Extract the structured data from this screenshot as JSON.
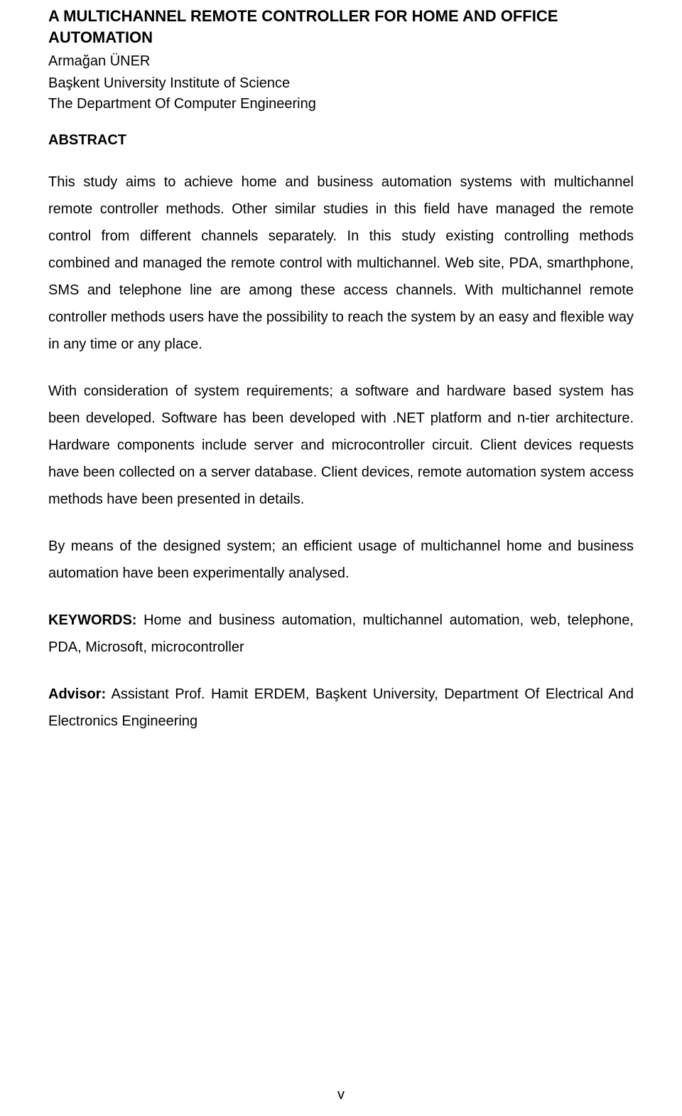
{
  "title": "A MULTICHANNEL REMOTE CONTROLLER FOR HOME AND OFFICE AUTOMATION",
  "author": "Armağan ÜNER",
  "affiliation": "Başkent University Institute of Science",
  "department": "The Department Of Computer Engineering",
  "abstract_heading": "ABSTRACT",
  "paragraphs": {
    "p1": "This study aims to achieve home and business automation systems with multichannel remote controller methods. Other similar studies in this field have managed the remote control from different channels separately. In this study existing controlling methods combined and managed the remote control with multichannel. Web site, PDA, smarthphone, SMS and telephone line are among these access channels. With multichannel remote controller methods users have the possibility to reach the system by an easy and flexible way in any time or any place.",
    "p2": "With consideration of system requirements; a software and hardware based system has been developed. Software has been developed with .NET platform and n-tier architecture. Hardware components include server and microcontroller circuit. Client devices requests have been collected on a server database. Client devices, remote automation system access methods have been presented in details.",
    "p3": "By means of the designed system; an efficient usage of multichannel home and business automation have been experimentally analysed."
  },
  "keywords_label": "KEYWORDS:",
  "keywords_text": " Home and business automation, multichannel automation, web, telephone, PDA, Microsoft, microcontroller",
  "advisor_label": "Advisor:",
  "advisor_text": " Assistant Prof. Hamit ERDEM, Başkent University, Department Of Electrical And Electronics Engineering",
  "page_number": "v"
}
